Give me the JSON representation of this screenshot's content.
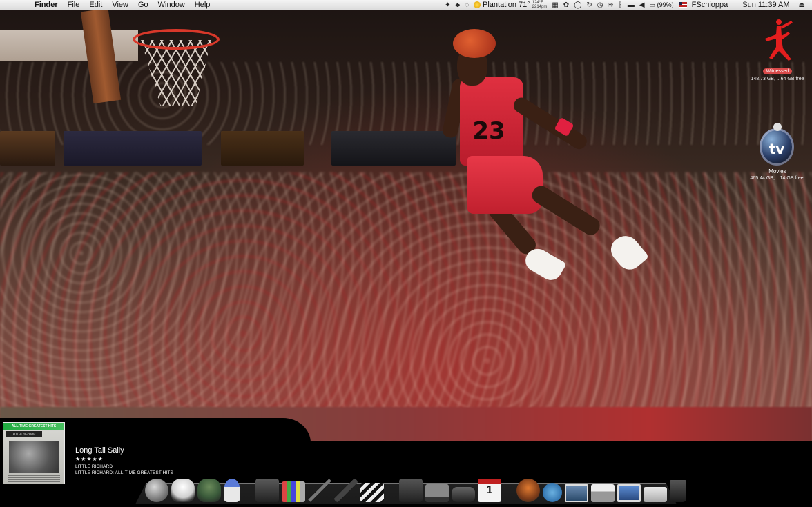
{
  "menubar": {
    "app_name": "Finder",
    "menus": [
      "File",
      "Edit",
      "View",
      "Go",
      "Window",
      "Help"
    ],
    "weather_location": "Plantation 71°",
    "weather_small_1": "124°F",
    "weather_small_2": "2214pm",
    "battery": "(99%)",
    "user": "FSchioppa",
    "clock": "Sun 11:39 AM"
  },
  "desktop": {
    "drive1": {
      "label": "Witnessed",
      "info": "148.73 GB, ...64 GB free",
      "icon": "jumpman-icon",
      "label_color": "#d84a4a"
    },
    "drive2": {
      "label": "iMovies",
      "info": "465.44 GB, ...14 GB free",
      "icon_text": "tv",
      "icon": "apple-tv-icon"
    }
  },
  "wallpaper": {
    "jersey_number": "23"
  },
  "now_playing": {
    "title": "Long Tall Sally",
    "stars": "★★★★★",
    "artist": "LITTLE RICHARD",
    "album": "LITTLE RICHARD: ALL-TIME GREATEST HITS",
    "cover_top_text": "ALL-TIME GREATEST HITS",
    "cover_artist_text": "LITTLE RICHARD"
  },
  "dock": {
    "calendar_day": "1",
    "items": [
      "death-star-icon",
      "stormtrooper-icon",
      "boba-fett-icon",
      "r2d2-icon",
      "camera-icon",
      "pencils-icon",
      "pen-icon",
      "brush-icon",
      "clapperboard-icon",
      "script-icon",
      "laptop-icon",
      "tablet-icon",
      "calendar-icon",
      "panther-icon",
      "sync-icon",
      "photo-icon",
      "printer-icon",
      "monitor-icon",
      "drive-icon",
      "trash-icon"
    ]
  }
}
